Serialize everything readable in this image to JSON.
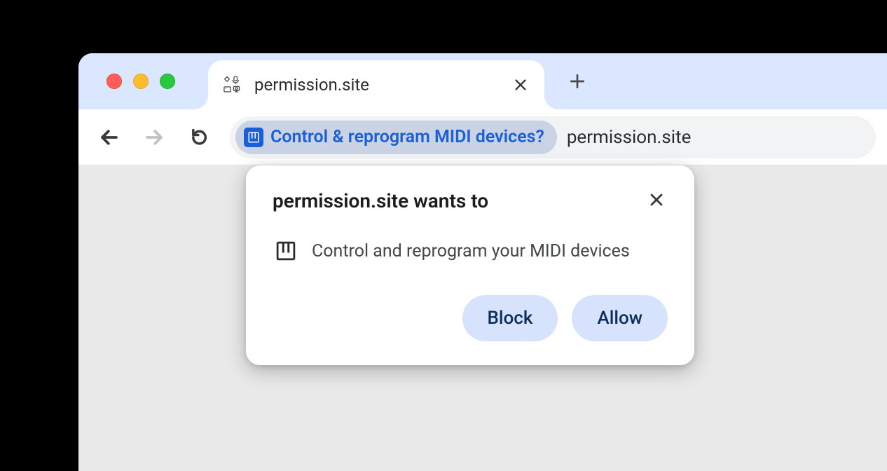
{
  "tab": {
    "title": "permission.site"
  },
  "omnibox": {
    "chip_text": "Control & reprogram MIDI devices?",
    "url": "permission.site"
  },
  "prompt": {
    "title": "permission.site wants to",
    "message": "Control and reprogram your MIDI devices",
    "block_label": "Block",
    "allow_label": "Allow"
  },
  "colors": {
    "chip_accent": "#1a5fd8",
    "button_bg": "#d7e3fc",
    "button_fg": "#0b2e5e"
  }
}
